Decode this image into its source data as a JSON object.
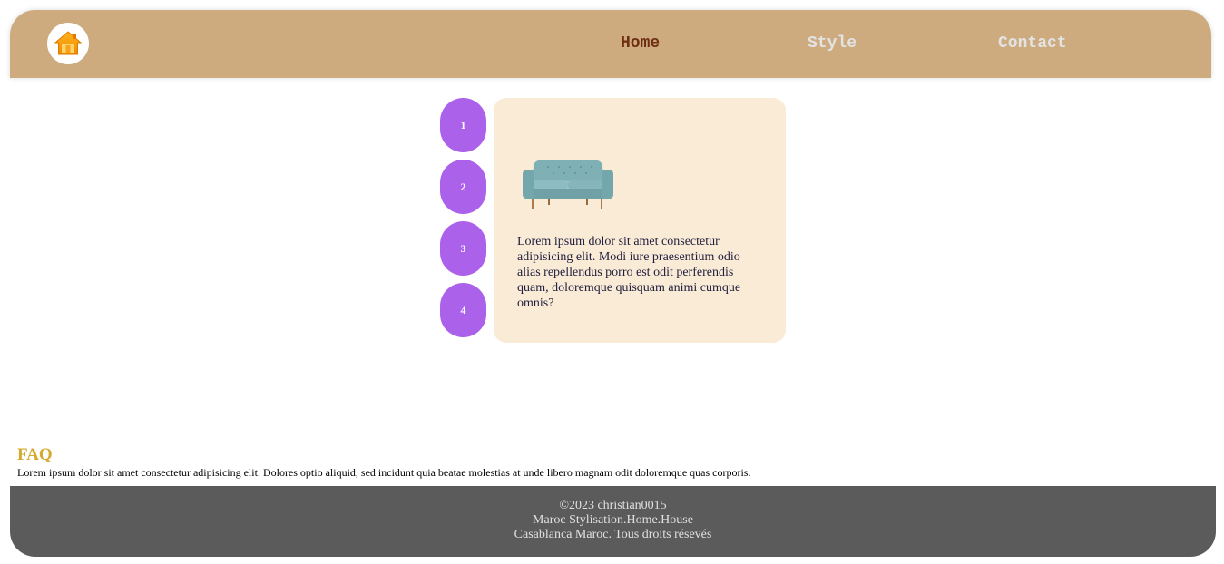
{
  "header": {
    "logo_icon": "home-icon",
    "nav": [
      {
        "label": "Home",
        "active": true
      },
      {
        "label": "Style",
        "active": false
      },
      {
        "label": "Contact",
        "active": false
      }
    ]
  },
  "steps": [
    "1",
    "2",
    "3",
    "4"
  ],
  "card": {
    "image_icon": "sofa-icon",
    "text": "Lorem ipsum dolor sit amet consectetur adipisicing elit. Modi iure praesentium odio alias repellendus porro est odit perferendis quam, doloremque quisquam animi cumque omnis?"
  },
  "faq": {
    "title": "FAQ",
    "text": "Lorem ipsum dolor sit amet consectetur adipisicing elit. Dolores optio aliquid, sed incidunt quia beatae molestias at unde libero magnam odit doloremque quas corporis."
  },
  "footer": {
    "line1": "©2023 christian0015",
    "line2": "Maroc Stylisation.Home.House",
    "line3": "Casablanca Maroc. Tous droits résevés"
  },
  "colors": {
    "header_bg": "#cdab7e",
    "nav_active": "#6e2e12",
    "nav_inactive": "#e3e3e3",
    "step_bg": "#ab61ea",
    "card_bg": "#faebd7",
    "faq_title": "#d4a92c",
    "footer_bg": "#5b5b5b"
  }
}
